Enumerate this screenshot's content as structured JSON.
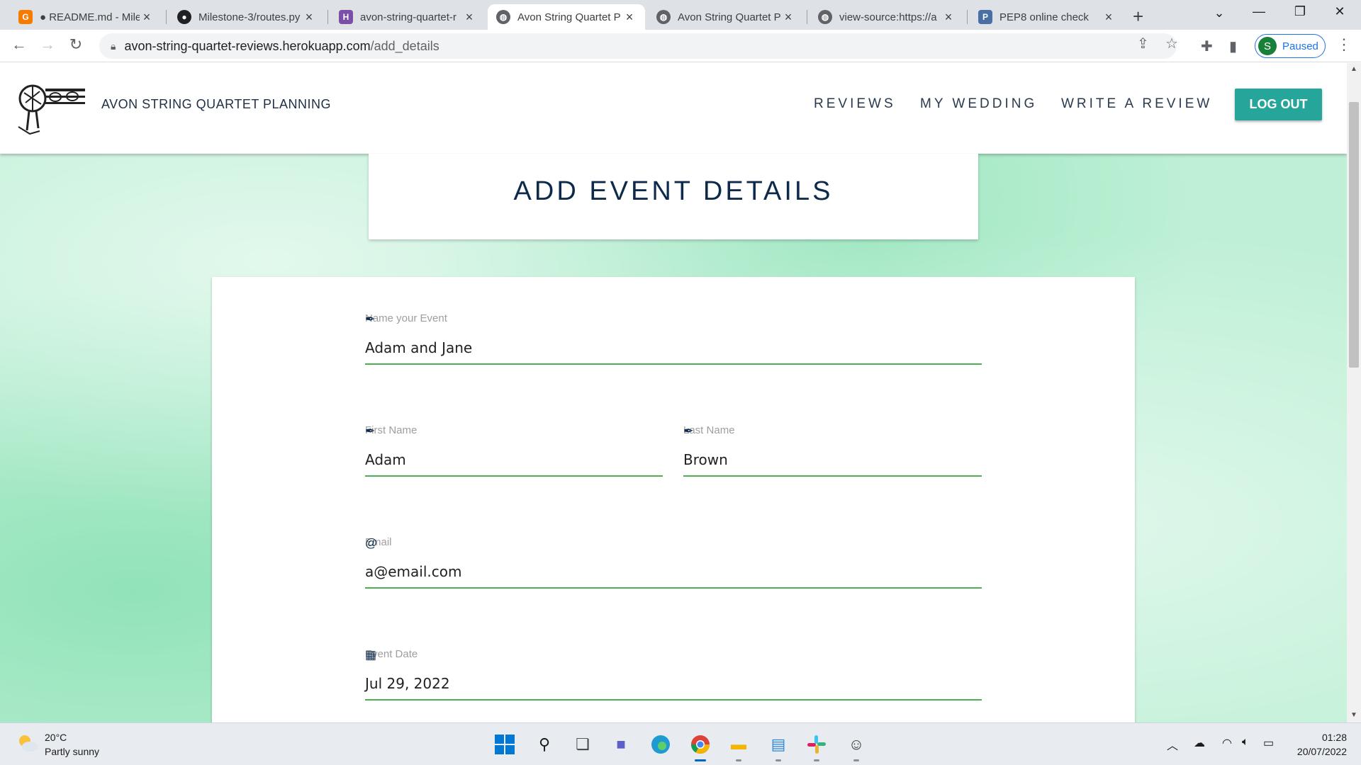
{
  "browser": {
    "tabs": [
      {
        "title": "● README.md - Miles",
        "favicon": "google-cloud-shell-icon",
        "active": false
      },
      {
        "title": "Milestone-3/routes.py",
        "favicon": "github-icon",
        "active": false
      },
      {
        "title": "avon-string-quartet-r",
        "favicon": "heroku-icon",
        "active": false
      },
      {
        "title": "Avon String Quartet P",
        "favicon": "globe-icon",
        "active": true
      },
      {
        "title": "Avon String Quartet P",
        "favicon": "globe-icon",
        "active": false
      },
      {
        "title": "view-source:https://a",
        "favicon": "globe-icon",
        "active": false
      },
      {
        "title": "PEP8 online check",
        "favicon": "pep8-icon",
        "active": false
      }
    ],
    "url_host": "avon-string-quartet-reviews.herokuapp.com",
    "url_path": "/add_details",
    "profile_initial": "S",
    "profile_status": "Paused"
  },
  "site": {
    "brand": "AVON STRING QUARTET PLANNING",
    "nav": [
      "REVIEWS",
      "MY WEDDING",
      "WRITE A REVIEW"
    ],
    "logout_label": "LOG OUT",
    "page_title": "ADD EVENT DETAILS"
  },
  "form": {
    "event_name": {
      "label": "Name your Event",
      "value": "Adam and Jane",
      "icon": "feather-icon"
    },
    "first_name": {
      "label": "First Name",
      "value": "Adam",
      "icon": "feather-icon"
    },
    "last_name": {
      "label": "Last Name",
      "value": "Brown",
      "icon": "feather-icon"
    },
    "email": {
      "label": "Email",
      "value": "a@email.com",
      "icon": "at-sign-icon"
    },
    "event_date": {
      "label": "Event Date",
      "value": "Jul 29, 2022",
      "icon": "calendar-icon"
    }
  },
  "taskbar": {
    "temperature": "20°C",
    "condition": "Partly sunny",
    "time": "01:28",
    "date": "20/07/2022",
    "apps": [
      "start-icon",
      "search-icon",
      "task-view-icon",
      "teams-chat-icon",
      "edge-icon",
      "chrome-icon",
      "file-explorer-icon",
      "notepad-icon",
      "slack-icon",
      "emoji-app-icon"
    ]
  }
}
